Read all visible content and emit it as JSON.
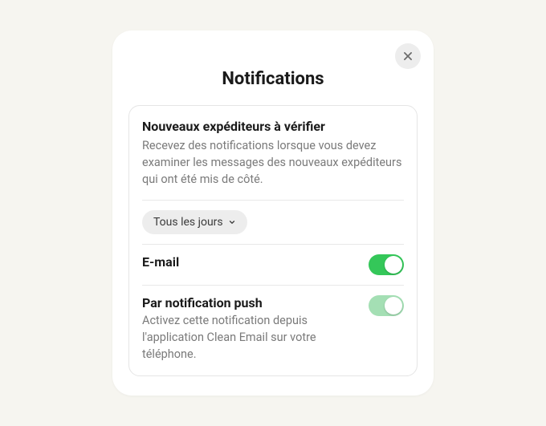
{
  "modal": {
    "title": "Notifications",
    "close_icon": "close-icon"
  },
  "section": {
    "title": "Nouveaux expéditeurs à vérifier",
    "description": "Recevez des notifications lorsque vous devez examiner les messages des nouveaux expéditeurs qui ont été mis de côté.",
    "frequency": {
      "selected": "Tous les jours"
    },
    "email": {
      "label": "E-mail",
      "enabled": true
    },
    "push": {
      "label": "Par notification push",
      "description": "Activez cette notification depuis l'application Clean Email sur votre téléphone.",
      "enabled": true
    }
  }
}
